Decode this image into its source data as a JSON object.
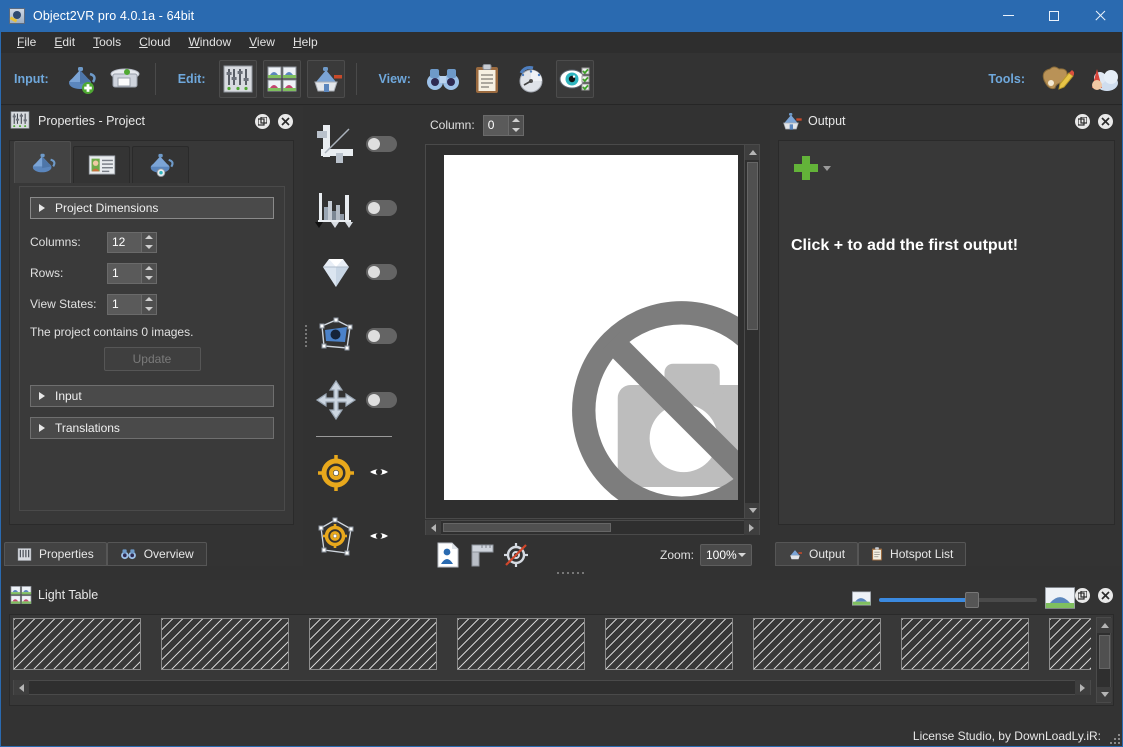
{
  "window": {
    "title": "Object2VR pro 4.0.1a - 64bit",
    "app_icon": "teapot-app-icon",
    "minimize": "–",
    "maximize": "□",
    "close": "×"
  },
  "menubar": {
    "items": [
      {
        "label": "File",
        "mnemonic": "F"
      },
      {
        "label": "Edit",
        "mnemonic": "E"
      },
      {
        "label": "Tools",
        "mnemonic": "T"
      },
      {
        "label": "Cloud",
        "mnemonic": "C"
      },
      {
        "label": "Window",
        "mnemonic": "W"
      },
      {
        "label": "View",
        "mnemonic": "V"
      },
      {
        "label": "Help",
        "mnemonic": "H"
      }
    ]
  },
  "toolbar": {
    "groups": [
      {
        "label": "Input:",
        "buttons": [
          {
            "name": "add-input-images-button",
            "icon": "teapot-plus-icon",
            "framed": false
          },
          {
            "name": "scanner-input-button",
            "icon": "scanner-icon",
            "framed": false
          }
        ]
      },
      {
        "label": "Edit:",
        "buttons": [
          {
            "name": "project-properties-button",
            "icon": "mixer-sliders-icon",
            "framed": true
          },
          {
            "name": "light-table-button",
            "icon": "thumbnail-grid-icon",
            "framed": true
          },
          {
            "name": "output-button",
            "icon": "output-teapot-icon",
            "framed": true
          }
        ]
      },
      {
        "label": "View:",
        "buttons": [
          {
            "name": "overview-button",
            "icon": "binoculars-icon",
            "framed": false
          },
          {
            "name": "hotspot-list-button",
            "icon": "clipboard-icon",
            "framed": false
          },
          {
            "name": "timing-button",
            "icon": "stopwatch-icon",
            "framed": false
          },
          {
            "name": "preview-button",
            "icon": "eye-checklist-icon",
            "framed": true
          }
        ]
      },
      {
        "label": "Tools:",
        "buttons": [
          {
            "name": "skin-editor-button",
            "icon": "palette-pencil-icon",
            "framed": false
          },
          {
            "name": "cloud-tools-button",
            "icon": "gnome-cloud-icon",
            "framed": false
          }
        ]
      }
    ]
  },
  "properties_panel": {
    "icon": "mixer-sliders-icon",
    "title": "Properties - Project",
    "float_button": "float-icon",
    "close_button": "close-icon",
    "tabs": [
      {
        "name": "tab-project",
        "icon": "teapot-icon",
        "active": true
      },
      {
        "name": "tab-user-data",
        "icon": "id-card-icon",
        "active": false
      },
      {
        "name": "tab-input",
        "icon": "teapot-settings-icon",
        "active": false
      }
    ],
    "sections": [
      {
        "name": "project-dimensions",
        "label": "Project Dimensions",
        "expanded": true,
        "highlighted": true
      },
      {
        "name": "input",
        "label": "Input",
        "expanded": false,
        "highlighted": false
      },
      {
        "name": "translations",
        "label": "Translations",
        "expanded": false,
        "highlighted": false
      }
    ],
    "fields": [
      {
        "name": "columns-field",
        "label": "Columns:",
        "value": "12"
      },
      {
        "name": "rows-field",
        "label": "Rows:",
        "value": "1"
      },
      {
        "name": "view-states-field",
        "label": "View States:",
        "value": "1"
      }
    ],
    "info_text": "The project contains 0 images.",
    "update_button": "Update",
    "bottom_tabs": [
      {
        "name": "tab-properties",
        "label": "Properties",
        "icon": "mixer-sliders-icon",
        "active": true
      },
      {
        "name": "tab-overview",
        "label": "Overview",
        "icon": "binoculars-icon",
        "active": false
      }
    ]
  },
  "tool_strip": {
    "items": [
      {
        "name": "crop-tool",
        "icon": "crop-icon",
        "control": "toggle",
        "on": false
      },
      {
        "name": "levels-tool",
        "icon": "histogram-icon",
        "control": "toggle",
        "on": false
      },
      {
        "name": "quality-tool",
        "icon": "diamond-icon",
        "control": "toggle",
        "on": false
      },
      {
        "name": "perspective-tool",
        "icon": "perspective-photo-icon",
        "control": "toggle",
        "on": false
      },
      {
        "name": "move-tool",
        "icon": "move-arrows-icon",
        "control": "toggle",
        "on": false
      },
      {
        "name": "center-point-tool",
        "icon": "target-icon",
        "control": "eye",
        "visible": true
      },
      {
        "name": "perspective-center-tool",
        "icon": "perspective-target-icon",
        "control": "eye",
        "visible": true
      }
    ]
  },
  "viewer": {
    "column_label": "Column:",
    "column_value": "0",
    "image_placeholder": "no-image-icon",
    "bottom_icons": [
      {
        "name": "hotspot-tool",
        "icon": "document-person-icon"
      },
      {
        "name": "measure-tool",
        "icon": "ruler-icon"
      },
      {
        "name": "no-center-tool",
        "icon": "target-crossed-icon"
      }
    ],
    "zoom_label": "Zoom:",
    "zoom_value": "100%"
  },
  "output_panel": {
    "icon": "output-teapot-icon",
    "title": "Output",
    "float_button": "float-icon",
    "close_button": "close-icon",
    "add_button": "add-output-button",
    "empty_message": "Click + to add the first output!",
    "tabs": [
      {
        "name": "tab-output",
        "label": "Output",
        "icon": "output-teapot-icon",
        "active": true
      },
      {
        "name": "tab-hotspot-list",
        "label": "Hotspot List",
        "icon": "clipboard-icon",
        "active": false
      }
    ]
  },
  "light_table": {
    "icon": "thumbnail-grid-icon",
    "title": "Light Table",
    "float_button": "float-icon",
    "close_button": "close-icon",
    "small_thumb_icon": "small-teapot-icon",
    "large_thumb_icon": "large-teapot-icon",
    "zoom_slider_percent": 55,
    "cell_count": 8
  },
  "statusbar": {
    "text": "License Studio, by DownLoadLy.iR:"
  },
  "colors": {
    "titlebar": "#2a6ab0",
    "panel_bg": "#333333",
    "panel_inner": "#383838",
    "accent_label": "#6fa8dc",
    "add_green": "#63b339",
    "slider_blue": "#3b8ae0",
    "text": "#e0e0e0"
  }
}
